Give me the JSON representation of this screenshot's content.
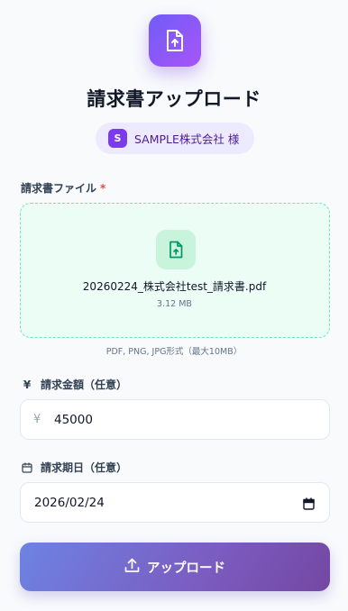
{
  "header": {
    "icon": "upload-file-icon",
    "title": "請求書アップロード",
    "company_initial": "S",
    "company_name": "SAMPLE株式会社 様"
  },
  "file_field": {
    "label": "請求書ファイル",
    "required_mark": "*",
    "file_name": "20260224_株式会社test_請求書.pdf",
    "file_size": "3.12 MB",
    "hint": "PDF, PNG, JPG形式（最大10MB）"
  },
  "amount_field": {
    "icon": "yen-icon",
    "icon_glyph": "¥",
    "label": "請求金額（任意）",
    "prefix": "¥",
    "value": "45000"
  },
  "date_field": {
    "icon": "calendar-icon",
    "label": "請求期日（任意）",
    "value": "2026/02/24"
  },
  "submit": {
    "icon": "upload-icon",
    "label": "アップロード"
  },
  "colors": {
    "accent": "#7c3aed",
    "dropzone_bg": "#ecfdf5",
    "dropzone_border": "#6ee7b7",
    "file_icon": "#059669"
  }
}
